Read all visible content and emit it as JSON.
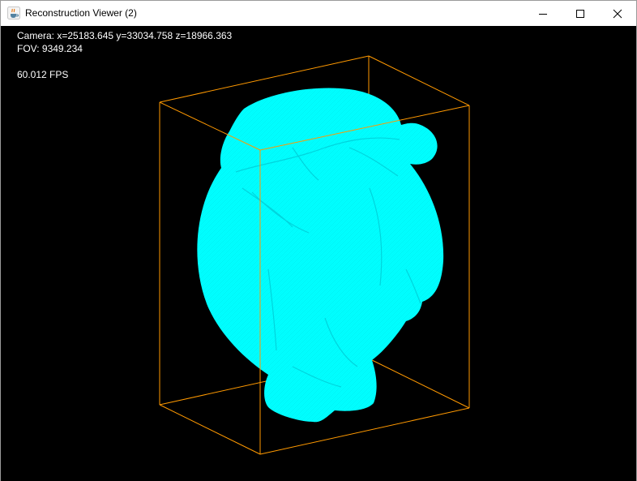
{
  "window": {
    "title": "Reconstruction Viewer (2)",
    "app_icon": "java-coffee-cup-icon",
    "controls": [
      "minimize-icon",
      "maximize-icon",
      "close-icon"
    ]
  },
  "hud": {
    "camera": "Camera: x=25183.645 y=33034.758 z=18966.363",
    "fov": "FOV: 9349.234",
    "fps": "60.012 FPS"
  },
  "scene": {
    "background": "#000000",
    "mesh_color": "#00ffff",
    "bounding_box_color": "#ff9900"
  }
}
